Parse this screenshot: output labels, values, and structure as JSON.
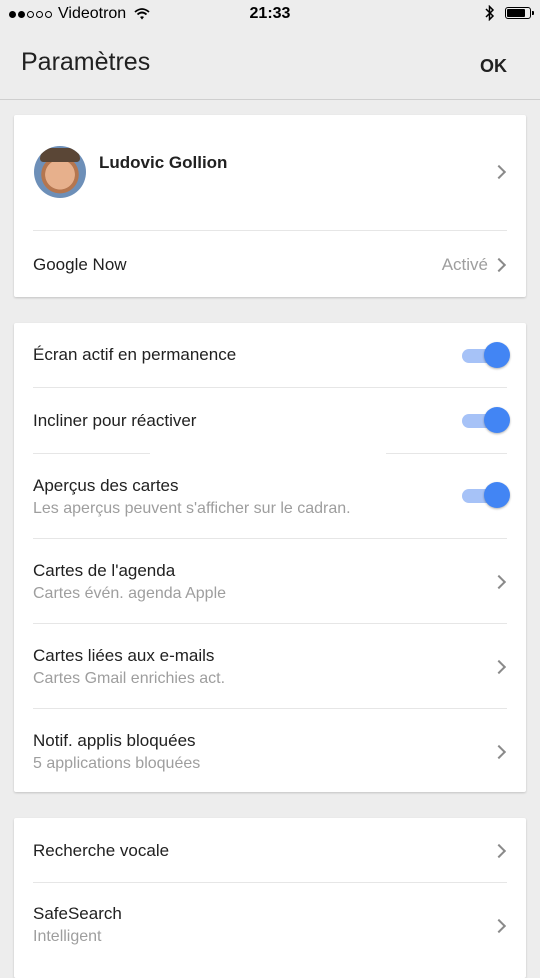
{
  "status_bar": {
    "carrier": "Videotron",
    "time": "21:33",
    "signal_bars_filled": 2,
    "signal_bars_total": 5,
    "icons": [
      "wifi-icon",
      "bluetooth-icon",
      "battery-icon"
    ]
  },
  "header": {
    "title": "Paramètres",
    "ok_label": "OK"
  },
  "profile_card": {
    "name": "Ludovic Gollion",
    "google_now": {
      "label": "Google Now",
      "value": "Activé"
    }
  },
  "settings_card": {
    "screen_always_on": {
      "label": "Écran actif en permanence",
      "enabled": true
    },
    "tilt_to_wake": {
      "label": "Incliner pour réactiver",
      "enabled": true
    },
    "card_previews": {
      "label": "Aperçus des cartes",
      "subtitle": "Les aperçus peuvent s'afficher sur le cadran.",
      "enabled": true
    },
    "calendar_cards": {
      "label": "Cartes de l'agenda",
      "subtitle": "Cartes évén. agenda Apple"
    },
    "email_cards": {
      "label": "Cartes liées aux e-mails",
      "subtitle": "Cartes Gmail enrichies act."
    },
    "blocked_app_notifs": {
      "label": "Notif. applis bloquées",
      "subtitle": "5 applications bloquées"
    }
  },
  "search_card": {
    "voice_search": {
      "label": "Recherche vocale"
    },
    "safesearch": {
      "label": "SafeSearch",
      "subtitle": "Intelligent"
    }
  },
  "colors": {
    "accent": "#4285f4",
    "accent_track": "#a6c2f7",
    "background": "#ededed",
    "secondary_text": "#9e9e9e"
  }
}
